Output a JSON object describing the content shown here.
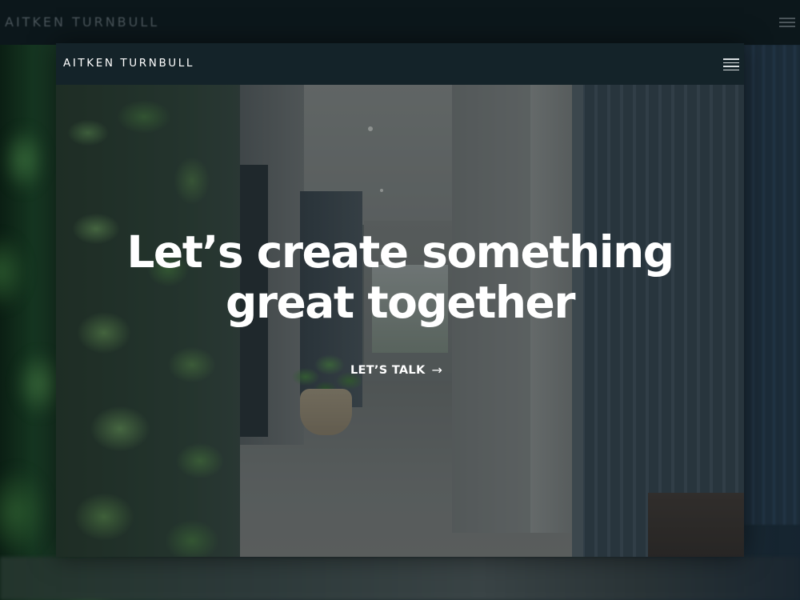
{
  "background_page": {
    "logo_text": "AITKEN TURNBULL",
    "menu_icon": "hamburger-menu-icon"
  },
  "header": {
    "logo_text": "AITKEN TURNBULL",
    "menu_icon": "hamburger-menu-icon"
  },
  "hero": {
    "title": "Let’s create something\ngreat together",
    "cta_label": "LET’S TALK",
    "cta_icon": "arrow-right-icon",
    "cta_arrow_glyph": "→"
  },
  "colors": {
    "header_bg": "#142329",
    "page_bg": "#0b1518",
    "text_primary": "#ffffff"
  }
}
